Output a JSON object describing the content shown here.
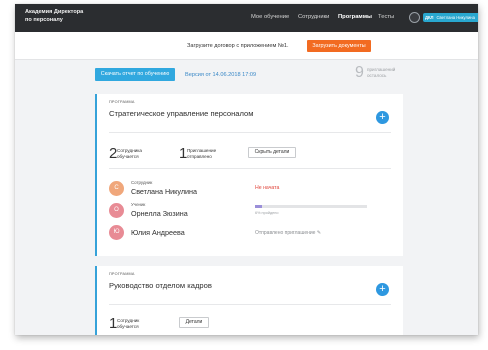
{
  "navbar": {
    "brand_line1": "Академия Директора",
    "brand_line2": "по персоналу",
    "items": [
      "Мое обучение",
      "Сотрудники",
      "Программы",
      "Тесты"
    ],
    "active_item": "Программы",
    "user_code": "ДКЛ",
    "user_name": "Светлана Никулина"
  },
  "upload": {
    "text": "Загрузите договор с приложением №1.",
    "button": "Загрузить документы"
  },
  "report": {
    "button": "Скачать отчет по обучению",
    "version": "Версия от 14.06.2018 17:09",
    "invites_count": "9",
    "invites_line1": "приглашений",
    "invites_line2": "осталось"
  },
  "programs": [
    {
      "kicker": "ПРОГРАММА",
      "title": "Стратегическое управление персоналом",
      "add_icon": "+",
      "stats": [
        {
          "num": "2",
          "line1": "Сотрудника",
          "line2": "обучается"
        },
        {
          "num": "1",
          "line1": "Приглашение",
          "line2": "отправлено"
        }
      ],
      "details_button": "Скрыть детали",
      "people": [
        {
          "initial": "С",
          "role": "Сотрудник",
          "name": "Светлана Никулина",
          "status": "Не начата",
          "avatar_color": "#f0a77b"
        },
        {
          "initial": "О",
          "role": "Ученик",
          "name": "Орнелла Зюзина",
          "progress": 0.06,
          "progress_text": "6% пройдено",
          "avatar_color": "#e88b95"
        },
        {
          "initial": "Ю",
          "role": "",
          "name": "Юлия Андреева",
          "invite_text": "Отправлено приглашение ✎",
          "avatar_color": "#e88b95"
        }
      ]
    },
    {
      "kicker": "ПРОГРАММА",
      "title": "Руководство отделом кадров",
      "add_icon": "+",
      "stats": [
        {
          "num": "1",
          "line1": "Сотрудник",
          "line2": "обучается"
        }
      ],
      "details_button": "Детали"
    }
  ],
  "colors": {
    "navbar": "#2b2d30",
    "accent_blue": "#31a8df",
    "accent_orange": "#f26b21",
    "status_red": "#e0453b"
  }
}
